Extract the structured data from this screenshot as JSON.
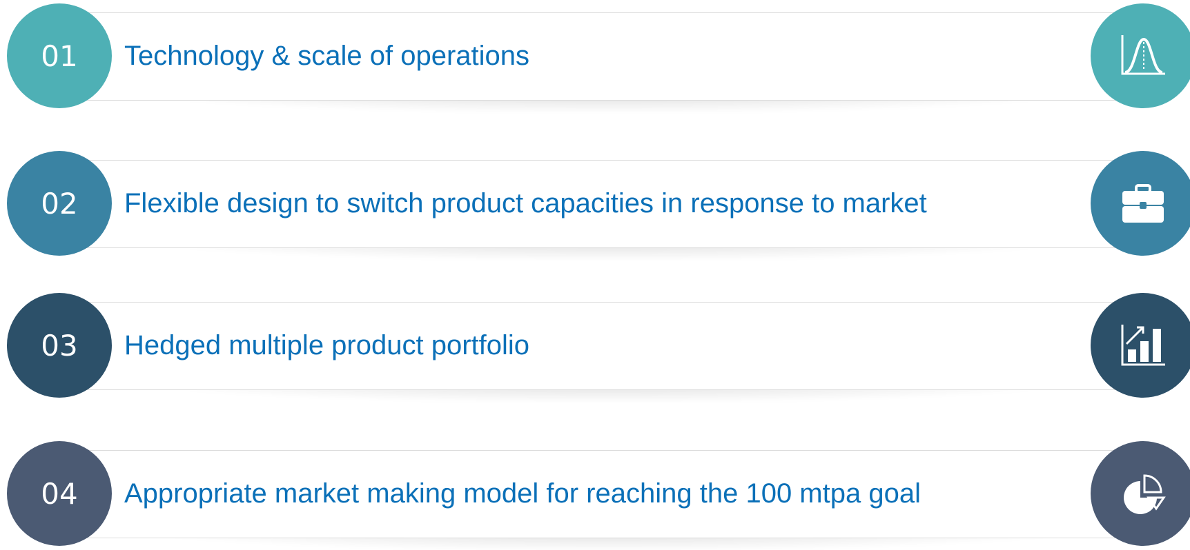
{
  "items": [
    {
      "number": "01",
      "label": "Technology & scale of operations",
      "icon": "bell-curve-chart-icon",
      "color": "#4eb0b5"
    },
    {
      "number": "02",
      "label": "Flexible design to switch product capacities in response to market",
      "icon": "briefcase-icon",
      "color": "#3a83a3"
    },
    {
      "number": "03",
      "label": "Hedged multiple product portfolio",
      "icon": "bar-chart-growth-icon",
      "color": "#2c5069"
    },
    {
      "number": "04",
      "label": "Appropriate market making model for reaching the 100 mtpa goal",
      "icon": "pie-chart-icon",
      "color": "#4b5a73"
    }
  ]
}
